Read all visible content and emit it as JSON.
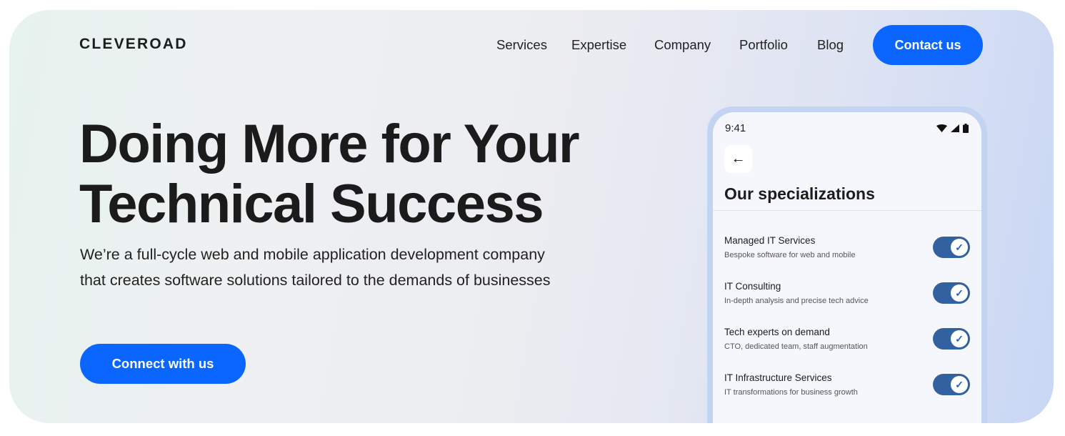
{
  "header": {
    "logo": "CLEVEROAD",
    "nav": [
      "Services",
      "Expertise",
      "Company",
      "Portfolio",
      "Blog"
    ],
    "contact_label": "Contact us"
  },
  "hero": {
    "title_line1": "Doing More for Your",
    "title_line2": "Technical Success",
    "subtitle_line1": "We’re a full-cycle web and mobile application development company",
    "subtitle_line2": "that creates software solutions tailored to the demands of businesses",
    "cta_label": "Connect with us"
  },
  "phone": {
    "time": "9:41",
    "title": "Our specializations",
    "icons": [
      "wifi-icon",
      "signal-icon",
      "battery-icon",
      "arrow-left-icon",
      "check-icon"
    ],
    "items": [
      {
        "title": "Managed IT Services",
        "desc": "Bespoke software for web and mobile",
        "on": true
      },
      {
        "title": "IT Consulting",
        "desc": "In-depth analysis and precise tech advice",
        "on": true
      },
      {
        "title": "Tech experts on demand",
        "desc": "CTO, dedicated team, staff augmentation",
        "on": true
      },
      {
        "title": "IT Infrastructure Services",
        "desc": "IT transformations for business growth",
        "on": true
      }
    ]
  },
  "colors": {
    "accent": "#0a66ff",
    "toggle": "#33609e"
  }
}
